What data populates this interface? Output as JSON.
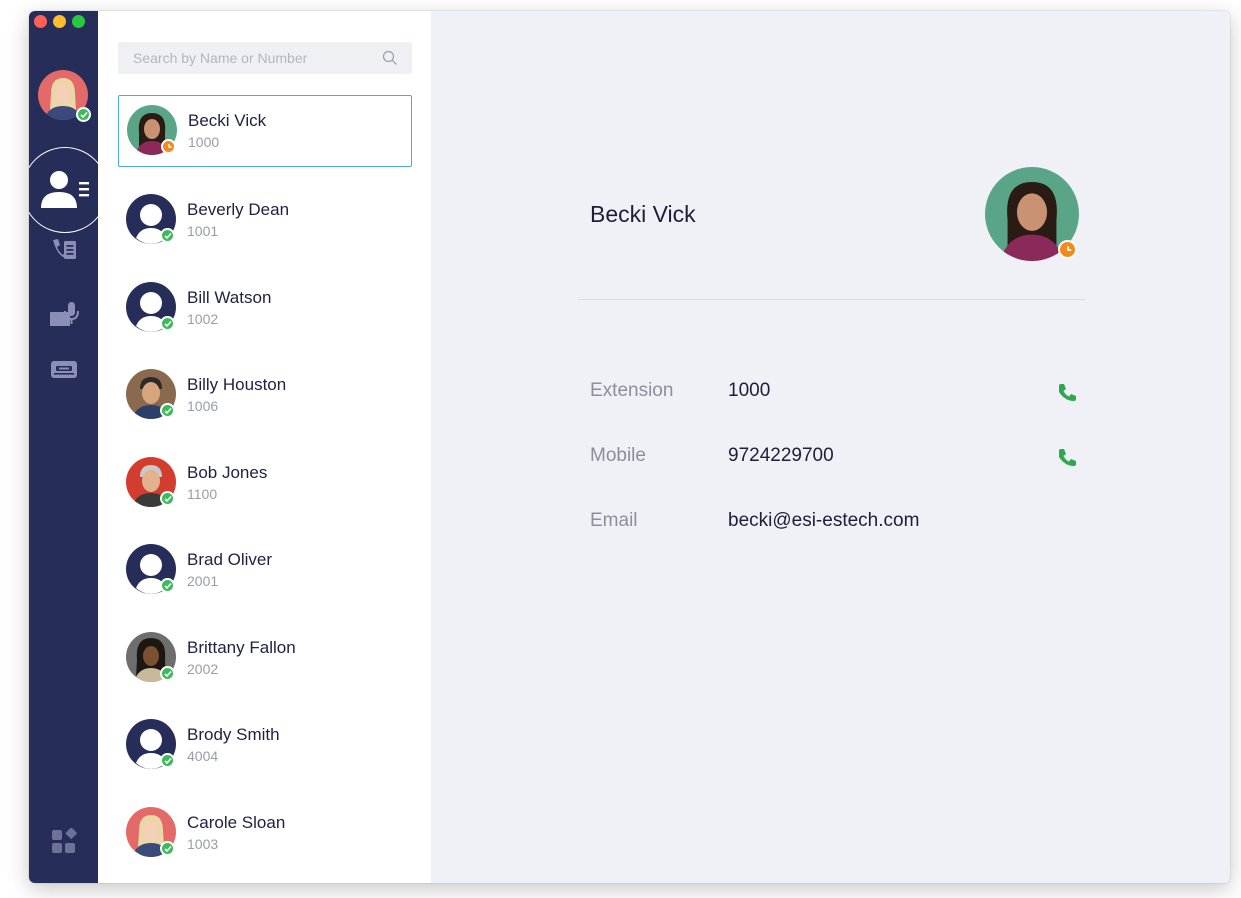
{
  "window": {
    "traffic_lights": [
      "close",
      "minimize",
      "maximize"
    ]
  },
  "rail": {
    "current_user": {
      "avatar": "current-user-photo",
      "status": "available"
    },
    "nav": [
      {
        "id": "contacts",
        "icon": "contacts-icon",
        "active": true
      },
      {
        "id": "call-history",
        "icon": "call-history-icon",
        "active": false
      },
      {
        "id": "voicemail",
        "icon": "voicemail-icon",
        "active": false
      },
      {
        "id": "fax",
        "icon": "fax-icon",
        "active": false
      }
    ],
    "bottom": {
      "icon": "apps-icon"
    }
  },
  "search": {
    "placeholder": "Search by Name or Number",
    "value": ""
  },
  "contacts": [
    {
      "name": "Becki Vick",
      "ext": "1000",
      "status": "away",
      "selected": true
    },
    {
      "name": "Beverly Dean",
      "ext": "1001",
      "status": "available"
    },
    {
      "name": "Bill Watson",
      "ext": "1002",
      "status": "available"
    },
    {
      "name": "Billy Houston",
      "ext": "1006",
      "status": "available"
    },
    {
      "name": "Bob Jones",
      "ext": "1100",
      "status": "available"
    },
    {
      "name": "Brad Oliver",
      "ext": "2001",
      "status": "available"
    },
    {
      "name": "Brittany Fallon",
      "ext": "2002",
      "status": "available"
    },
    {
      "name": "Brody Smith",
      "ext": "4004",
      "status": "available"
    },
    {
      "name": "Carole Sloan",
      "ext": "1003",
      "status": "available"
    }
  ],
  "detail": {
    "name": "Becki Vick",
    "status": "away",
    "fields": [
      {
        "label": "Extension",
        "value": "1000",
        "callable": true
      },
      {
        "label": "Mobile",
        "value": "9724229700",
        "callable": true
      },
      {
        "label": "Email",
        "value": "becki@esi-estech.com",
        "callable": false
      }
    ]
  },
  "colors": {
    "rail": "#262d59",
    "available": "#3dbb5a",
    "away": "#f28b1c",
    "call": "#2fa84f",
    "selection": "#4fa7dc"
  }
}
